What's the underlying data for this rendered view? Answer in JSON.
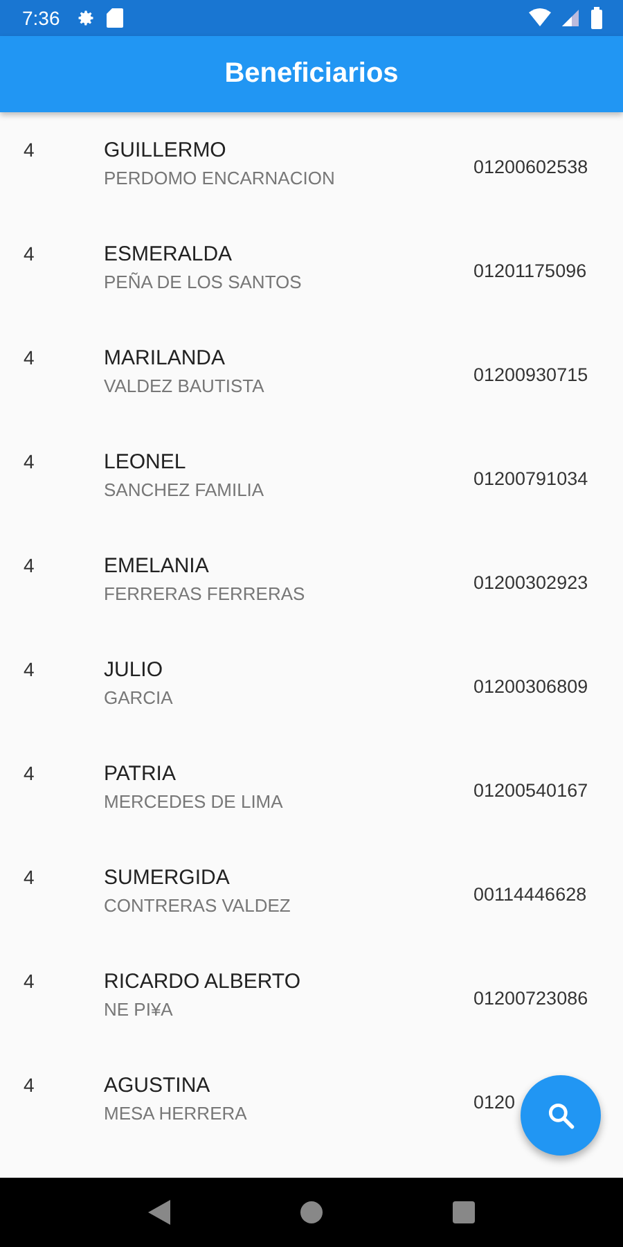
{
  "status_bar": {
    "time": "7:36"
  },
  "app_bar": {
    "title": "Beneficiarios"
  },
  "rows": [
    {
      "number": "4",
      "first_name": "GUILLERMO",
      "last_name": "PERDOMO ENCARNACION",
      "id": "01200602538"
    },
    {
      "number": "4",
      "first_name": "ESMERALDA",
      "last_name": "PEÑA DE LOS SANTOS",
      "id": "01201175096"
    },
    {
      "number": "4",
      "first_name": "MARILANDA",
      "last_name": "VALDEZ BAUTISTA",
      "id": "01200930715"
    },
    {
      "number": "4",
      "first_name": "LEONEL",
      "last_name": "SANCHEZ FAMILIA",
      "id": "01200791034"
    },
    {
      "number": "4",
      "first_name": "EMELANIA",
      "last_name": "FERRERAS FERRERAS",
      "id": "01200302923"
    },
    {
      "number": "4",
      "first_name": "JULIO",
      "last_name": "GARCIA",
      "id": "01200306809"
    },
    {
      "number": "4",
      "first_name": "PATRIA",
      "last_name": "MERCEDES DE LIMA",
      "id": "01200540167"
    },
    {
      "number": "4",
      "first_name": "SUMERGIDA",
      "last_name": "CONTRERAS VALDEZ",
      "id": "00114446628"
    },
    {
      "number": "4",
      "first_name": "RICARDO ALBERTO",
      "last_name": "NE PI¥A",
      "id": "01200723086"
    },
    {
      "number": "4",
      "first_name": "AGUSTINA",
      "last_name": "MESA HERRERA",
      "id": "0120"
    }
  ]
}
